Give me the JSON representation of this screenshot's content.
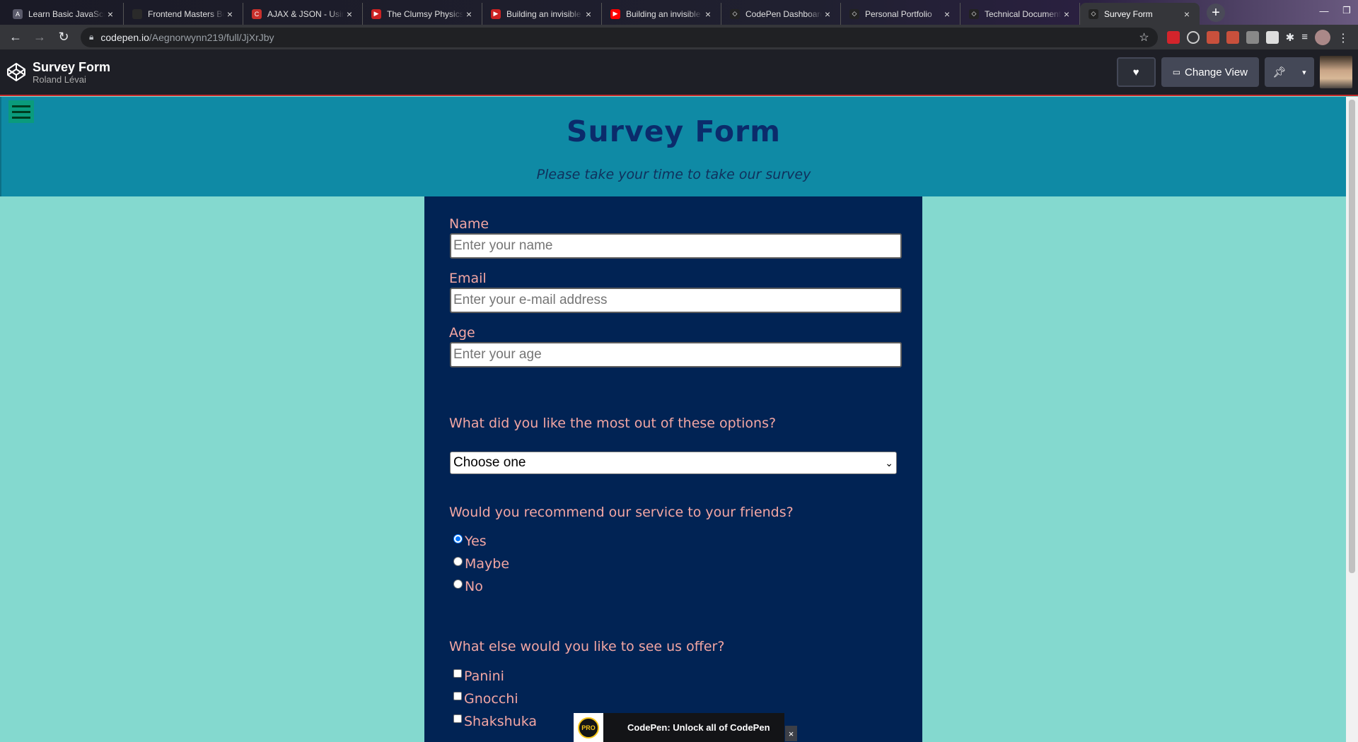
{
  "browser": {
    "tabs": [
      {
        "title": "Learn Basic JavaScript",
        "favicon_color": "#5a5a6a",
        "favicon": "A"
      },
      {
        "title": "Frontend Masters Boo",
        "favicon_color": "#2a2a2a",
        "favicon": ""
      },
      {
        "title": "AJAX & JSON - Using",
        "favicon_color": "#c8302c",
        "favicon": "C"
      },
      {
        "title": "The Clumsy Physics",
        "favicon_color": "#cc2222",
        "favicon": "▶"
      },
      {
        "title": "Building an invisible",
        "favicon_color": "#cc2222",
        "favicon": "▶"
      },
      {
        "title": "Building an invisible",
        "favicon_color": "#ff0000",
        "favicon": "▶"
      },
      {
        "title": "CodePen Dashboard",
        "favicon_color": "#222",
        "favicon": "◇"
      },
      {
        "title": "Personal Portfolio",
        "favicon_color": "#222",
        "favicon": "◇"
      },
      {
        "title": "Technical Document",
        "favicon_color": "#222",
        "favicon": "◇"
      },
      {
        "title": "Survey Form",
        "favicon_color": "#222",
        "favicon": "◇"
      }
    ],
    "tab_close": "×",
    "new_tab": "+",
    "url_host": "codepen.io",
    "url_path": "/Aegnorwynn219/full/JjXrJby"
  },
  "codepen": {
    "title": "Survey Form",
    "author": "Roland Lévai",
    "change_view": "Change View"
  },
  "hero": {
    "title": "Survey Form",
    "description": "Please take your time to take our survey"
  },
  "form": {
    "name_label": "Name",
    "name_placeholder": "Enter your name",
    "email_label": "Email",
    "email_placeholder": "Enter your e-mail address",
    "age_label": "Age",
    "age_placeholder": "Enter your age",
    "q_like": "What did you like the most out of these options?",
    "select_value": "Choose one",
    "q_recommend": "Would you recommend our service to your friends?",
    "radio_options": [
      "Yes",
      "Maybe",
      "No"
    ],
    "radio_selected": "Yes",
    "q_offer": "What else would you like to see us offer?",
    "checkbox_options": [
      "Panini",
      "Gnocchi",
      "Shakshuka"
    ]
  },
  "promo": {
    "badge": "PRO",
    "text": "CodePen: Unlock all of CodePen",
    "close": "×"
  },
  "colors": {
    "page_bg": "#84d9cf",
    "hero_bg": "#0f8aa5",
    "form_bg": "#012354",
    "label_color": "#f3a6a3",
    "title_color": "#0b2b6b"
  }
}
